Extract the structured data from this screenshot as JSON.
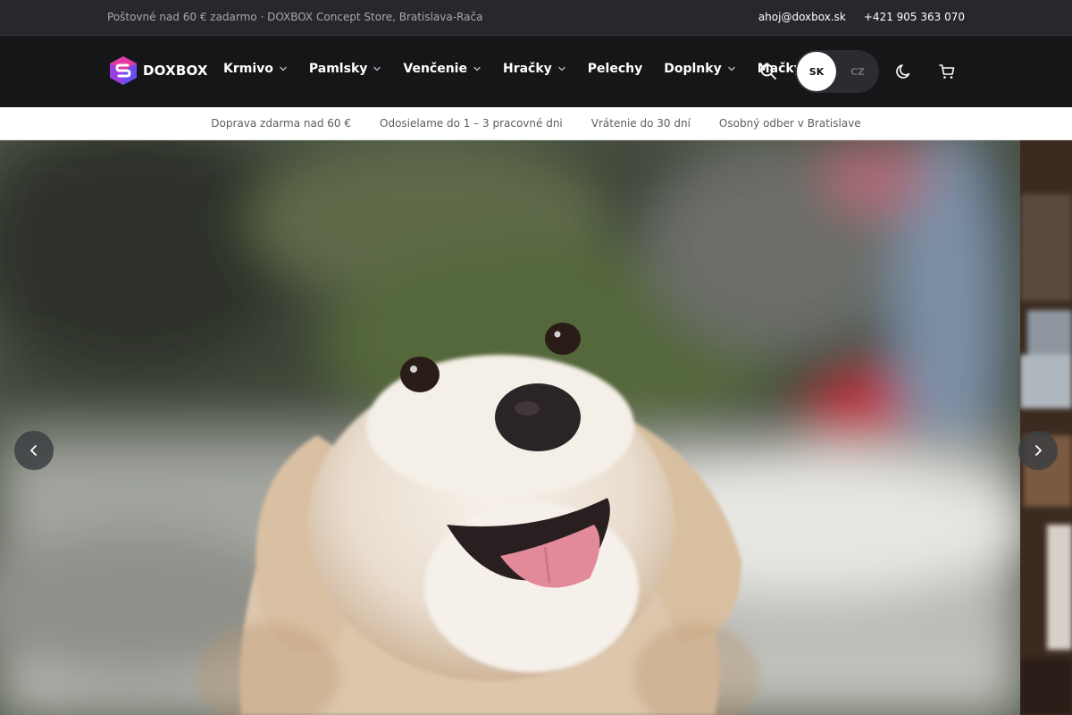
{
  "topbar": {
    "promo": "Poštovné nad 60 € zadarmo · DOXBOX Concept Store, Bratislava-Rača",
    "email": "ahoj@doxbox.sk",
    "phone": "+421 905 363 070"
  },
  "brand": {
    "name": "DOXBOX"
  },
  "menu": [
    {
      "label": "Krmivo",
      "dropdown": true
    },
    {
      "label": "Pamlsky",
      "dropdown": true
    },
    {
      "label": "Venčenie",
      "dropdown": true
    },
    {
      "label": "Hračky",
      "dropdown": true
    },
    {
      "label": "Pelechy",
      "dropdown": false
    },
    {
      "label": "Doplnky",
      "dropdown": true
    },
    {
      "label": "Mačky",
      "dropdown": true
    }
  ],
  "language": {
    "active": "SK",
    "other": "CZ"
  },
  "benefits": [
    "Doprava zdarma nad 60 €",
    "Odosielame do 1 – 3 pracovné dni",
    "Vrátenie do 30 dní",
    "Osobný odber v Bratislave"
  ],
  "icons": {
    "search": "search-icon",
    "theme": "moon-icon",
    "cart": "cart-icon",
    "prev": "chevron-left-icon",
    "next": "chevron-right-icon"
  },
  "colors": {
    "topbar_bg": "#26282c",
    "nav_bg": "#151618",
    "benefits_bg": "#ffffff",
    "logo_pink": "#e23aa0",
    "logo_purple": "#6b4cf0"
  }
}
